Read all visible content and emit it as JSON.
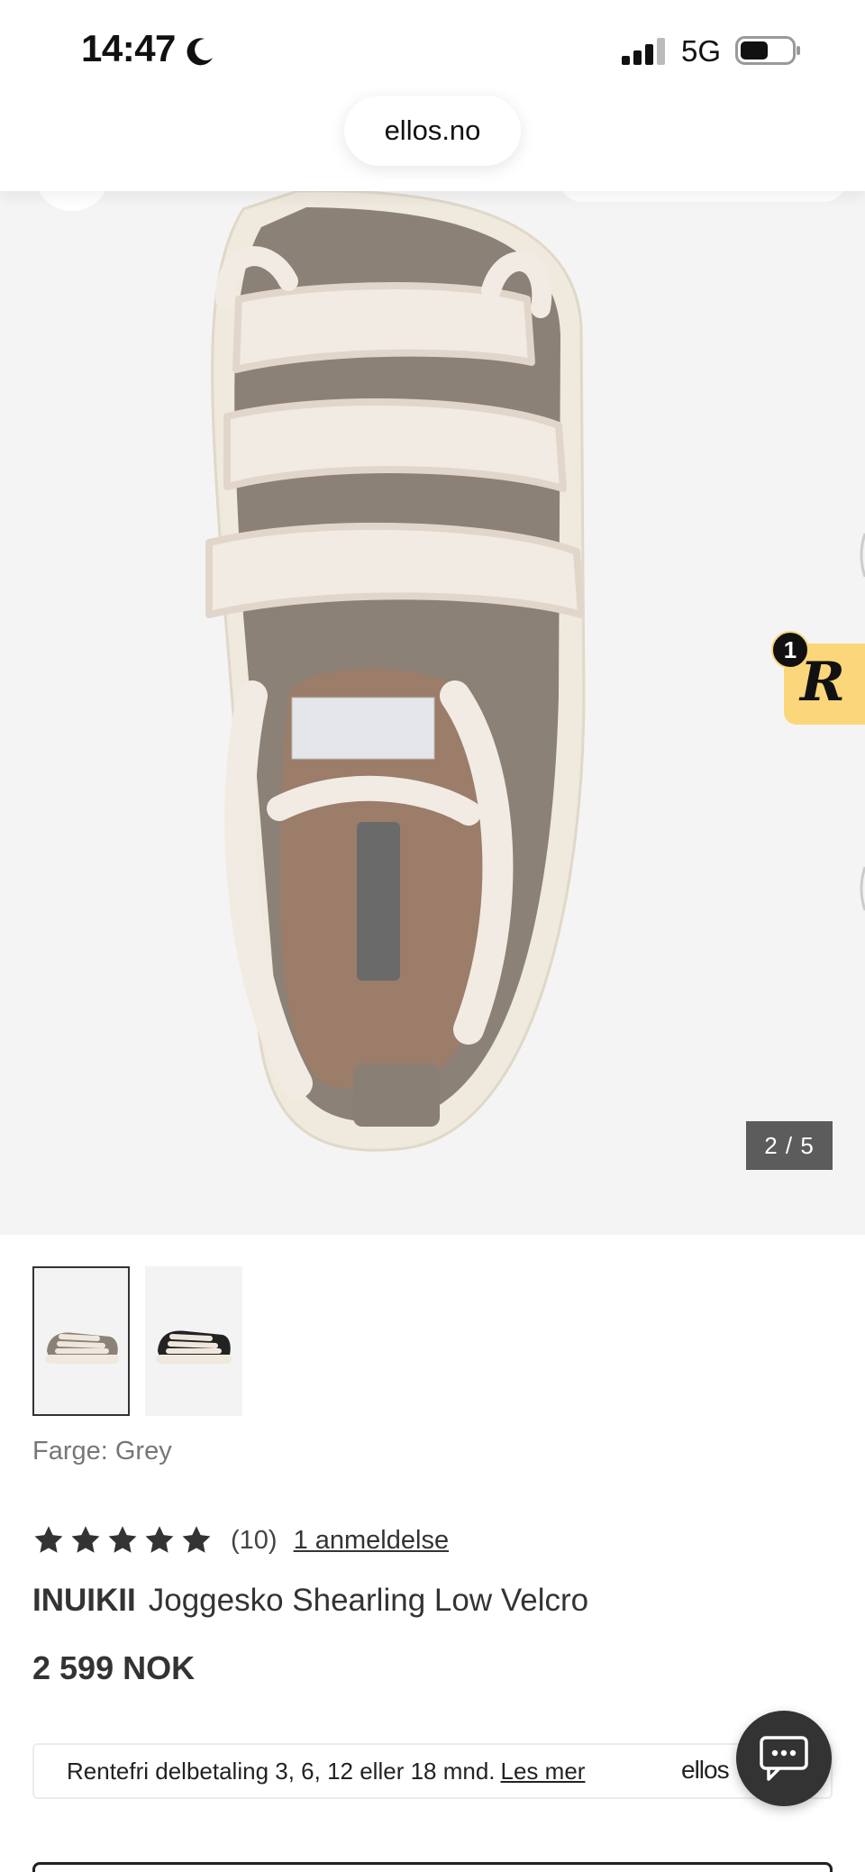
{
  "status_bar": {
    "time": "14:47",
    "network": "5G",
    "icons": [
      "moon-icon",
      "signal-icon",
      "battery-icon"
    ]
  },
  "browser": {
    "url": "ellos.no"
  },
  "gallery": {
    "counter": "2 / 5",
    "current_image": 2,
    "total_images": 5,
    "thumbnails": [
      "thumbnail-grey",
      "thumbnail-black"
    ]
  },
  "badge": {
    "letter": "R",
    "count": "1",
    "color": "#fcd67a"
  },
  "product": {
    "color_label": "Farge: Grey",
    "rating": 5,
    "rating_count": "(10)",
    "review_link": "1 anmeldelse",
    "brand": "INUIKII",
    "name": "Joggesko Shearling Low Velcro",
    "price": "2 599 NOK"
  },
  "finance": {
    "text": "Rentefri delbetaling 3, 6, 12 eller 18 mnd.",
    "link": "Les mer",
    "logo": "ellos"
  },
  "colors": {
    "text": "#333333",
    "muted": "#777777",
    "hero_bg": "#f4f4f4",
    "counter_bg": "#5c5c5c"
  }
}
